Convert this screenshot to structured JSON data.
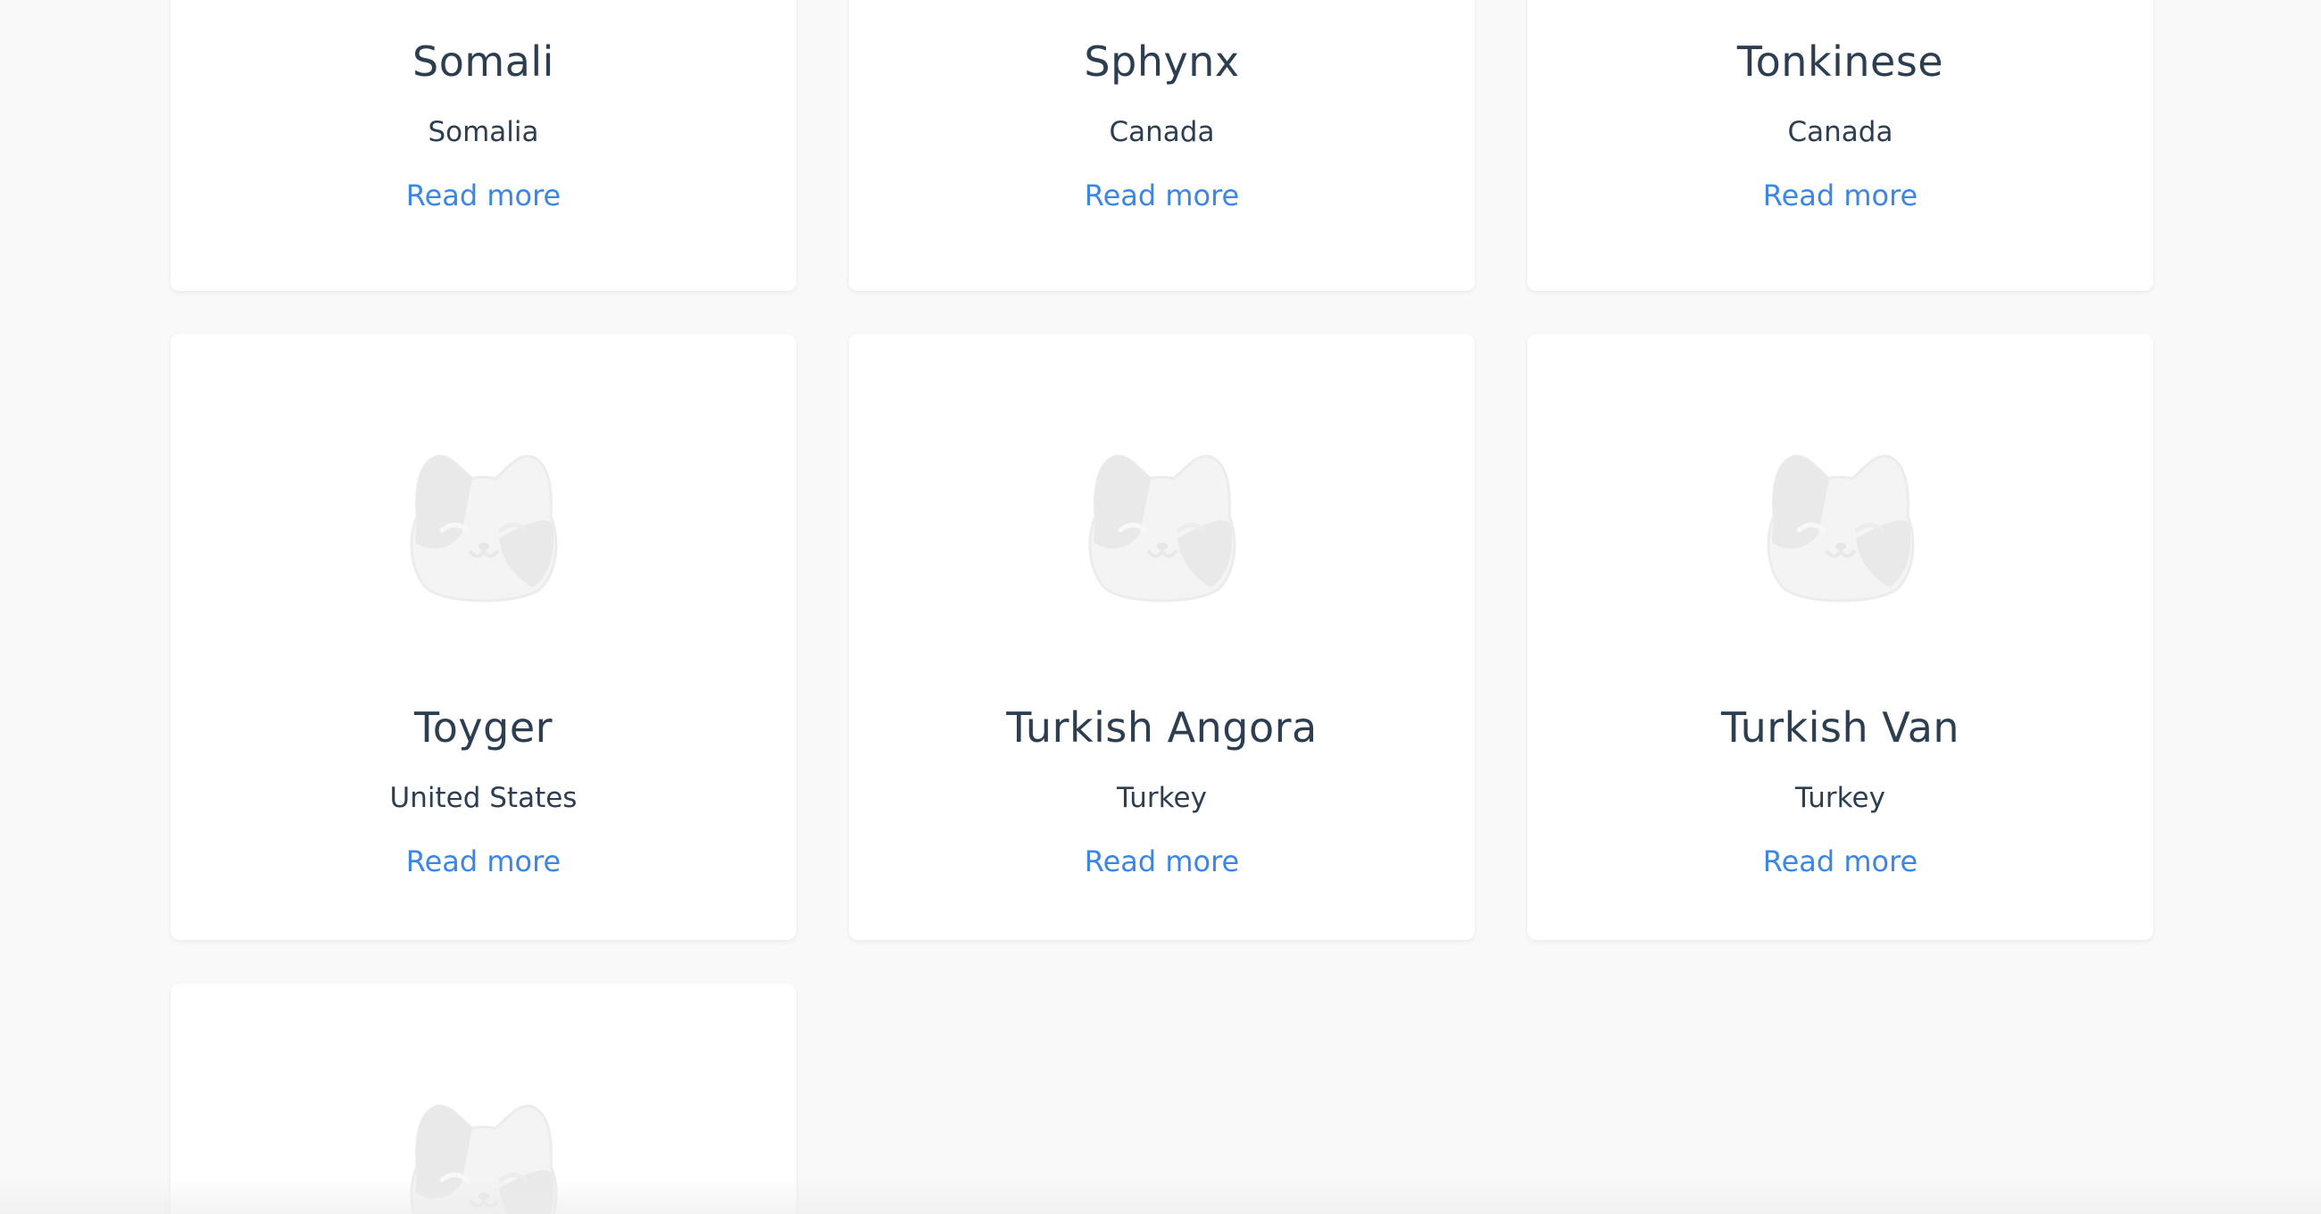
{
  "cards": [
    {
      "name": "Somali",
      "origin": "Somalia",
      "link": "Read more",
      "image": "cat-placeholder-icon"
    },
    {
      "name": "Sphynx",
      "origin": "Canada",
      "link": "Read more",
      "image": "cat-placeholder-icon"
    },
    {
      "name": "Tonkinese",
      "origin": "Canada",
      "link": "Read more",
      "image": "cat-placeholder-icon"
    },
    {
      "name": "Toyger",
      "origin": "United States",
      "link": "Read more",
      "image": "cat-placeholder-icon"
    },
    {
      "name": "Turkish Angora",
      "origin": "Turkey",
      "link": "Read more",
      "image": "cat-placeholder-icon"
    },
    {
      "name": "Turkish Van",
      "origin": "Turkey",
      "link": "Read more",
      "image": "cat-placeholder-icon"
    },
    {
      "name": "",
      "origin": "",
      "link": "",
      "image": "cat-placeholder-icon"
    }
  ],
  "colors": {
    "background": "#f9f9f9",
    "card": "#ffffff",
    "heading": "#2c3e50",
    "link": "#3b86e6",
    "placeholder": "#efefef"
  }
}
